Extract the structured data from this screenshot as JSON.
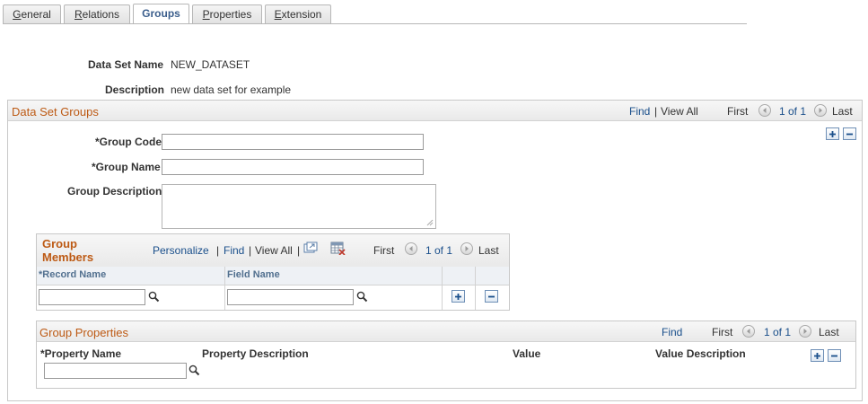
{
  "tabs": [
    {
      "label": "General",
      "underline": "G",
      "rest": "eneral"
    },
    {
      "label": "Relations",
      "underline": "R",
      "rest": "elations"
    },
    {
      "label": "Groups",
      "underline": "",
      "rest": "Groups"
    },
    {
      "label": "Properties",
      "underline": "P",
      "rest": "roperties"
    },
    {
      "label": "Extension",
      "underline": "E",
      "rest": "xtension"
    }
  ],
  "header": {
    "data_set_name_label": "Data Set Name",
    "data_set_name_value": "NEW_DATASET",
    "description_label": "Description",
    "description_value": "new data set for example"
  },
  "groups_section": {
    "title": "Data Set Groups",
    "find": "Find",
    "sep": "|",
    "view_all": "View All",
    "first": "First",
    "counter": "1 of 1",
    "last": "Last",
    "group_code_label": "*Group Code",
    "group_code_value": "",
    "group_name_label": "*Group Name",
    "group_name_value": "",
    "group_desc_label": "Group Description",
    "group_desc_value": ""
  },
  "members_grid": {
    "title": "Group Members",
    "personalize": "Personalize",
    "sep1": "|",
    "find": "Find",
    "sep2": "|",
    "view_all": "View All",
    "sep3": "|",
    "first": "First",
    "counter": "1 of 1",
    "last": "Last",
    "col_record": "*Record Name",
    "col_field": "Field Name",
    "record_value": "",
    "field_value": ""
  },
  "properties_section": {
    "title": "Group Properties",
    "find": "Find",
    "first": "First",
    "counter": "1 of 1",
    "last": "Last",
    "col_name": "*Property Name",
    "col_desc": "Property Description",
    "col_value": "Value",
    "col_value_desc": "Value Description",
    "name_value": ""
  },
  "icons": {
    "accent": "#1a4f8b",
    "section_title_color": "#bd5a14"
  }
}
